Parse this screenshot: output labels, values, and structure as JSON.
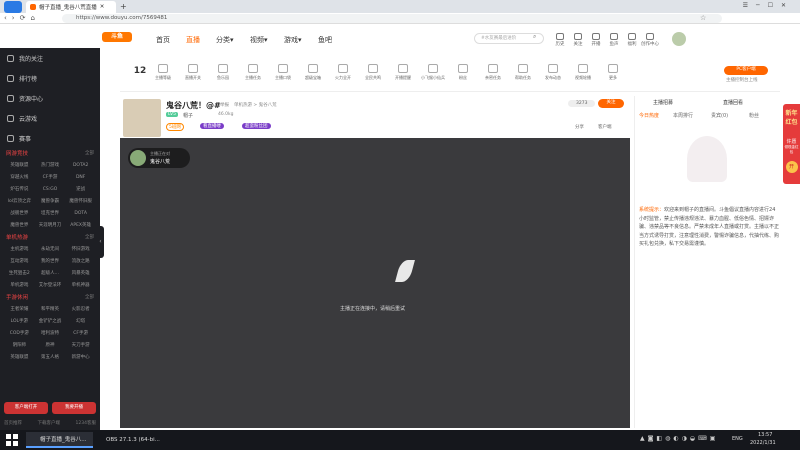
{
  "browser": {
    "tab_title": "帽子直播_鬼谷八荒直播",
    "url": "https://www.douyu.com/7569481"
  },
  "header": {
    "logo": "斗鱼",
    "nav": [
      "首页",
      "直播",
      "分类▾",
      "视频▾",
      "游戏▾",
      "鱼吧"
    ],
    "search_placeholder": "#水友赛最后进阶",
    "icons": [
      "历史",
      "关注",
      "开播",
      "鱼声",
      "福利",
      "创作中心"
    ]
  },
  "leftnav": {
    "main": [
      "我的关注",
      "排行榜",
      "资源中心",
      "云游戏",
      "赛事"
    ],
    "sections": [
      {
        "title": "网游竞技",
        "more": "全部",
        "items": [
          "英雄联盟",
          "热门游戏",
          "DOTA2",
          "穿越火线",
          "CF手游",
          "DNF",
          "炉石传说",
          "CS:GO",
          "逆战",
          "lol云顶之弈",
          "魔兽争霸",
          "魔兽怀旧服",
          "战舰世界",
          "坦克世界",
          "DOTA",
          "魔兽世界",
          "天涯明月刀",
          "APEX英雄"
        ]
      },
      {
        "title": "单机热游",
        "more": "全部",
        "items": [
          "主机游戏",
          "永劫无间",
          "怀旧游戏",
          "互动游戏",
          "我的世界",
          "流放之路",
          "生死狙击2",
          "超级人...",
          "风暴英雄",
          "单机游戏",
          "艾尔登法环",
          "单机神器"
        ]
      },
      {
        "title": "手游休闲",
        "more": "全部",
        "items": [
          "王者荣耀",
          "和平精英",
          "火影忍者",
          "LOL手游",
          "金铲铲之战",
          "幻塔",
          "COD手游",
          "哈利波特",
          "CF手游",
          "阴阳师",
          "原神",
          "天刀手游",
          "英雄联盟",
          "第五人格",
          "新游中心"
        ]
      }
    ],
    "bottom_btns": [
      "客户端打开",
      "我要开播"
    ],
    "footer": [
      "首页推荐",
      "下载客户端",
      "1234客服"
    ]
  },
  "giftbar": {
    "level_num": "12",
    "items": [
      "主播等级",
      "直播开关",
      "鱼乐园",
      "主播任务",
      "主播口袋",
      "超级宝箱",
      "火力全开",
      "全民共鸣",
      "开播提醒",
      "小飞猴小仙兵",
      "粉丝",
      "亲密任务",
      "帮助任务",
      "发布动态",
      "视频轮播",
      "更多"
    ],
    "pc_btn": "PC客户端",
    "pc_sub": "主播控制台上线"
  },
  "room": {
    "title": "鬼谷八荒！@#",
    "report": "举报",
    "category": "单机热游 > 鬼谷八荒",
    "anchor": "帽子",
    "weight": "46.0kg",
    "followers": "3273",
    "follow_btn": "关注",
    "share": "分享",
    "client": "客户端",
    "tags": [
      "5班网",
      "看直播喽",
      "超蛮粉丝团"
    ],
    "badge": "LV5"
  },
  "video": {
    "anchor_label": "主播正在对",
    "anchor_name": "鬼谷八荒",
    "status": "主播正在连接中，请稍后重试"
  },
  "chat": {
    "tabs": [
      "今日热度",
      "本周排行",
      "贵宾(0)",
      "粉丝"
    ],
    "top_tabs": [
      "主播招募",
      "直播回看"
    ],
    "sys_label": "系统提示：",
    "sys_msg": "欢迎来到帽子的直播间。斗鱼倡议直播内容进行24小时监管，禁止传播违规违法、暴力血腥、低俗色情、招嫖诈骗、违禁品等不良信息。严禁未成年人直播或打赏。主播以不正当方式诱导打赏，注意理性消费，警惕诈骗信息，代抽代练、购买礼包兑换，私下交易需谨慎。"
  },
  "redpack": {
    "line1": "新年",
    "line2": "红包",
    "line3": "许愿",
    "line4": "领现金红包",
    "btn": "开"
  },
  "taskbar": {
    "apps": [
      "帽子直播_鬼谷八...",
      "OBS 27.1.3 (64-bi..."
    ],
    "lang": "ENG",
    "time": "13:57",
    "date": "2022/1/31"
  }
}
